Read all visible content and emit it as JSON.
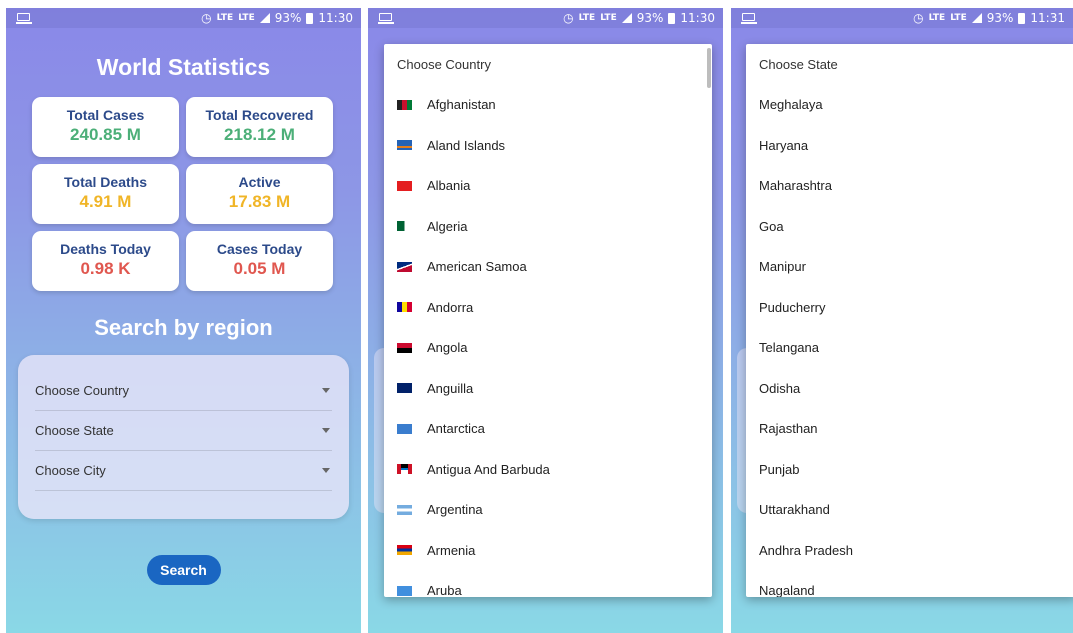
{
  "status": {
    "left_icon": "monitor-icon",
    "alarm_icon": "alarm-icon",
    "lte1": "LTE",
    "lte2": "LTE",
    "battery": "93%",
    "time1": "11:30",
    "time2": "11:30",
    "time3": "11:31"
  },
  "home": {
    "title": "World Statistics",
    "cards": [
      {
        "label": "Total Cases",
        "value": "240.85 M",
        "color": "#4caf78"
      },
      {
        "label": "Total Recovered",
        "value": "218.12 M",
        "color": "#4caf78"
      },
      {
        "label": "Total Deaths",
        "value": "4.91 M",
        "color": "#f0b527"
      },
      {
        "label": "Active",
        "value": "17.83 M",
        "color": "#f0b527"
      },
      {
        "label": "Deaths Today",
        "value": "0.98 K",
        "color": "#e0574f"
      },
      {
        "label": "Cases Today",
        "value": "0.05 M",
        "color": "#e0574f"
      }
    ],
    "subtitle": "Search by region",
    "dropdowns": [
      "Choose Country",
      "Choose State",
      "Choose City"
    ],
    "search_label": "Search"
  },
  "country_menu": {
    "header": "Choose Country",
    "items": [
      "Afghanistan",
      "Aland Islands",
      "Albania",
      "Algeria",
      "American Samoa",
      "Andorra",
      "Angola",
      "Anguilla",
      "Antarctica",
      "Antigua And Barbuda",
      "Argentina",
      "Armenia",
      "Aruba"
    ]
  },
  "state_menu": {
    "header": "Choose State",
    "items": [
      "Meghalaya",
      "Haryana",
      "Maharashtra",
      "Goa",
      "Manipur",
      "Puducherry",
      "Telangana",
      "Odisha",
      "Rajasthan",
      "Punjab",
      "Uttarakhand",
      "Andhra Pradesh",
      "Nagaland"
    ]
  }
}
